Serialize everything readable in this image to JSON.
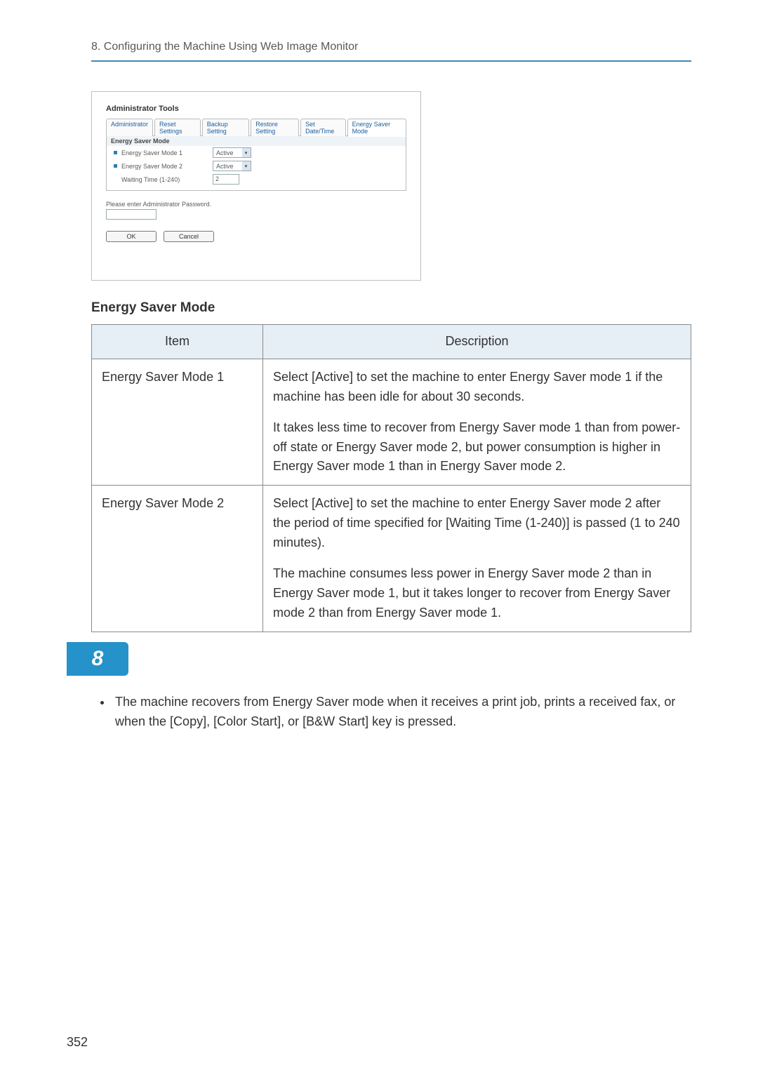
{
  "header": {
    "chapter_line": "8. Configuring the Machine Using Web Image Monitor"
  },
  "screenshot": {
    "title": "Administrator Tools",
    "tabs": [
      "Administrator",
      "Reset Settings",
      "Backup Setting",
      "Restore Setting",
      "Set Date/Time",
      "Energy Saver Mode"
    ],
    "section_head": "Energy Saver Mode",
    "rows": {
      "mode1": {
        "label": "Energy Saver Mode 1",
        "value": "Active"
      },
      "mode2": {
        "label": "Energy Saver Mode 2",
        "value": "Active"
      },
      "waiting": {
        "label": "Waiting Time (1-240)",
        "value": "2"
      }
    },
    "password_label": "Please enter Administrator Password.",
    "ok_button": "OK",
    "cancel_button": "Cancel"
  },
  "section_title": "Energy Saver Mode",
  "table": {
    "header_item": "Item",
    "header_desc": "Description",
    "rows": [
      {
        "item": "Energy Saver Mode 1",
        "paras": [
          "Select [Active] to set the machine to enter Energy Saver mode 1 if the machine has been idle for about 30 seconds.",
          "It takes less time to recover from Energy Saver mode 1 than from power-off state or Energy Saver mode 2, but power consumption is higher in Energy Saver mode 1 than in Energy Saver mode 2."
        ]
      },
      {
        "item": "Energy Saver Mode 2",
        "paras": [
          "Select [Active] to set the machine to enter Energy Saver mode 2 after the period of time specified for [Waiting Time (1-240)] is passed (1 to 240 minutes).",
          "The machine consumes less power in Energy Saver mode 2 than in Energy Saver mode 1, but it takes longer to recover from Energy Saver mode 2 than from Energy Saver mode 1."
        ]
      }
    ]
  },
  "chapter_tab": "8",
  "note": "The machine recovers from Energy Saver mode when it receives a print job, prints a received fax, or when the [Copy], [Color Start], or [B&W Start] key is pressed.",
  "page_number": "352"
}
